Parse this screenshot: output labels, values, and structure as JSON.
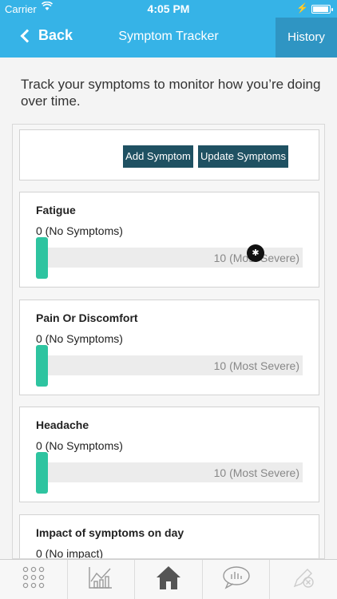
{
  "status": {
    "carrier": "Carrier",
    "time": "4:05 PM"
  },
  "nav": {
    "back_label": "Back",
    "title": "Symptom Tracker",
    "history_label": "History"
  },
  "intro": "Track your symptoms to monitor how you’re doing over time.",
  "actions": {
    "add_label": "Add Symptom",
    "update_label": "Update Symptoms"
  },
  "symptoms": [
    {
      "name": "Fatigue",
      "min_label": "0 (No Symptoms)",
      "max_label": "10 (Most Severe)",
      "value": 0
    },
    {
      "name": "Pain Or Discomfort",
      "min_label": "0 (No Symptoms)",
      "max_label": "10 (Most Severe)",
      "value": 0
    },
    {
      "name": "Headache",
      "min_label": "0 (No Symptoms)",
      "max_label": "10 (Most Severe)",
      "value": 0
    },
    {
      "name": "Impact of symptoms on day",
      "min_label": "0 (No impact)",
      "value": 0
    }
  ],
  "tabs": [
    "grid-icon",
    "chart-icon",
    "home-icon",
    "chat-icon",
    "edit-icon"
  ],
  "colors": {
    "header": "#36b3e7",
    "history_bg": "#2f95c3",
    "button": "#1f5162",
    "slider": "#2ec4a0"
  }
}
